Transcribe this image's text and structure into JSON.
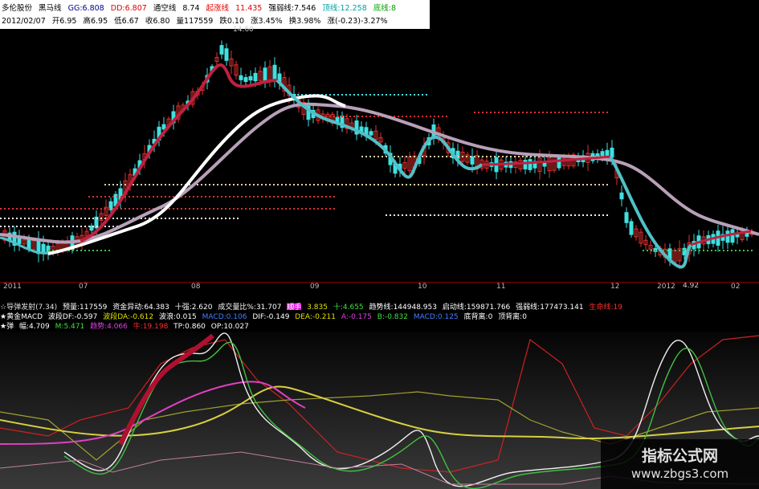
{
  "header": {
    "row1": [
      "多伦股份",
      "黑马线",
      "GG:6.808",
      "DD:6.807",
      "通空线",
      "8.74",
      "起涨线",
      "11.435",
      "强弱线:7.546",
      "顶线:12.258",
      "底线:8"
    ],
    "row2": [
      "2012/02/07",
      "开6.95",
      "高6.95",
      "低6.67",
      "收6.80",
      "量117559",
      "跌0.10",
      "涨3.45%",
      "换3.98%",
      "涨(-0.23)-3.27%"
    ]
  },
  "price_labels": {
    "high": "14.60",
    "low": "4.92"
  },
  "time_axis": [
    "2011",
    "07",
    "08",
    "09",
    "10",
    "11",
    "12",
    "2012",
    "02"
  ],
  "indicators": {
    "row1": [
      "☆导弹发射(7.34)",
      "预量:117559",
      "资金异动:64.383",
      "十强:2.620",
      "成交量比%:31.707",
      "顺手",
      "3.835",
      "十:4.655",
      "趋势线:144948.953",
      "启动线:159871.766",
      "强弱线:177473.141",
      "生命线:19"
    ],
    "row2": [
      "★黄金MACD",
      "波段DF:-0.597",
      "波段DA:-0.612",
      "波浪:0.015",
      "MACD:0.106",
      "DIF:-0.149",
      "DEA:-0.211",
      "A:-0.175",
      "B:-0.832",
      "MACD:0.125",
      "底背离:0",
      "顶背离:0"
    ],
    "row3": [
      "★弹",
      "幅:4.709",
      "M:5.471",
      "趋势:4.066",
      "牛:19.198",
      "TP:0.860",
      "OP:10.027"
    ]
  },
  "colors": {
    "up": "#e03030",
    "down": "#40e0e0",
    "ma_white": "#ffffff",
    "ma_purple": "#c8a8c8",
    "hdr_red": "#e00000",
    "hdr_green": "#00a000",
    "yellow": "#e0e000"
  },
  "watermark": {
    "title": "指标公式网",
    "url": "www.zbgs3.com"
  }
}
